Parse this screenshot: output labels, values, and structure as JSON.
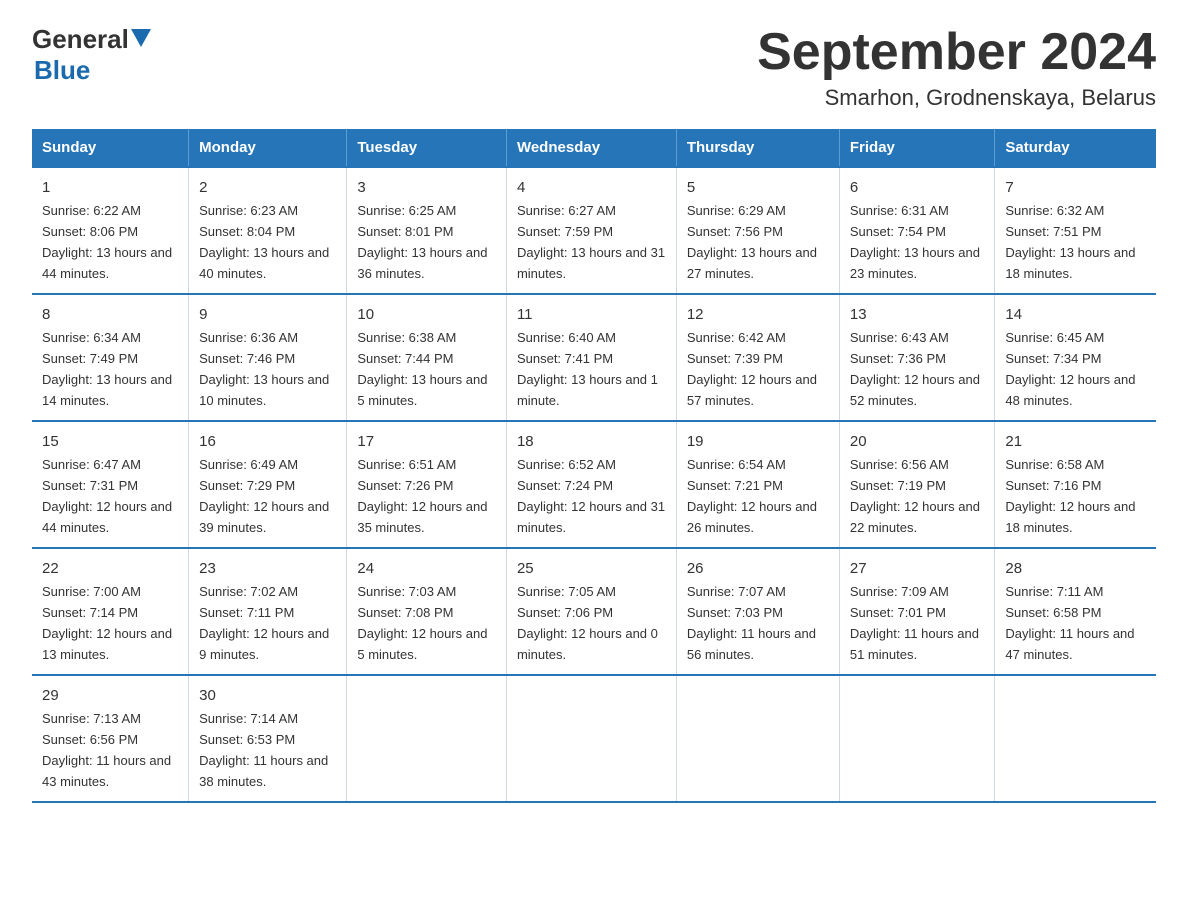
{
  "header": {
    "logo_general": "General",
    "logo_blue": "Blue",
    "main_title": "September 2024",
    "subtitle": "Smarhon, Grodnenskaya, Belarus"
  },
  "columns": [
    "Sunday",
    "Monday",
    "Tuesday",
    "Wednesday",
    "Thursday",
    "Friday",
    "Saturday"
  ],
  "weeks": [
    [
      {
        "day": "1",
        "sunrise": "Sunrise: 6:22 AM",
        "sunset": "Sunset: 8:06 PM",
        "daylight": "Daylight: 13 hours and 44 minutes."
      },
      {
        "day": "2",
        "sunrise": "Sunrise: 6:23 AM",
        "sunset": "Sunset: 8:04 PM",
        "daylight": "Daylight: 13 hours and 40 minutes."
      },
      {
        "day": "3",
        "sunrise": "Sunrise: 6:25 AM",
        "sunset": "Sunset: 8:01 PM",
        "daylight": "Daylight: 13 hours and 36 minutes."
      },
      {
        "day": "4",
        "sunrise": "Sunrise: 6:27 AM",
        "sunset": "Sunset: 7:59 PM",
        "daylight": "Daylight: 13 hours and 31 minutes."
      },
      {
        "day": "5",
        "sunrise": "Sunrise: 6:29 AM",
        "sunset": "Sunset: 7:56 PM",
        "daylight": "Daylight: 13 hours and 27 minutes."
      },
      {
        "day": "6",
        "sunrise": "Sunrise: 6:31 AM",
        "sunset": "Sunset: 7:54 PM",
        "daylight": "Daylight: 13 hours and 23 minutes."
      },
      {
        "day": "7",
        "sunrise": "Sunrise: 6:32 AM",
        "sunset": "Sunset: 7:51 PM",
        "daylight": "Daylight: 13 hours and 18 minutes."
      }
    ],
    [
      {
        "day": "8",
        "sunrise": "Sunrise: 6:34 AM",
        "sunset": "Sunset: 7:49 PM",
        "daylight": "Daylight: 13 hours and 14 minutes."
      },
      {
        "day": "9",
        "sunrise": "Sunrise: 6:36 AM",
        "sunset": "Sunset: 7:46 PM",
        "daylight": "Daylight: 13 hours and 10 minutes."
      },
      {
        "day": "10",
        "sunrise": "Sunrise: 6:38 AM",
        "sunset": "Sunset: 7:44 PM",
        "daylight": "Daylight: 13 hours and 5 minutes."
      },
      {
        "day": "11",
        "sunrise": "Sunrise: 6:40 AM",
        "sunset": "Sunset: 7:41 PM",
        "daylight": "Daylight: 13 hours and 1 minute."
      },
      {
        "day": "12",
        "sunrise": "Sunrise: 6:42 AM",
        "sunset": "Sunset: 7:39 PM",
        "daylight": "Daylight: 12 hours and 57 minutes."
      },
      {
        "day": "13",
        "sunrise": "Sunrise: 6:43 AM",
        "sunset": "Sunset: 7:36 PM",
        "daylight": "Daylight: 12 hours and 52 minutes."
      },
      {
        "day": "14",
        "sunrise": "Sunrise: 6:45 AM",
        "sunset": "Sunset: 7:34 PM",
        "daylight": "Daylight: 12 hours and 48 minutes."
      }
    ],
    [
      {
        "day": "15",
        "sunrise": "Sunrise: 6:47 AM",
        "sunset": "Sunset: 7:31 PM",
        "daylight": "Daylight: 12 hours and 44 minutes."
      },
      {
        "day": "16",
        "sunrise": "Sunrise: 6:49 AM",
        "sunset": "Sunset: 7:29 PM",
        "daylight": "Daylight: 12 hours and 39 minutes."
      },
      {
        "day": "17",
        "sunrise": "Sunrise: 6:51 AM",
        "sunset": "Sunset: 7:26 PM",
        "daylight": "Daylight: 12 hours and 35 minutes."
      },
      {
        "day": "18",
        "sunrise": "Sunrise: 6:52 AM",
        "sunset": "Sunset: 7:24 PM",
        "daylight": "Daylight: 12 hours and 31 minutes."
      },
      {
        "day": "19",
        "sunrise": "Sunrise: 6:54 AM",
        "sunset": "Sunset: 7:21 PM",
        "daylight": "Daylight: 12 hours and 26 minutes."
      },
      {
        "day": "20",
        "sunrise": "Sunrise: 6:56 AM",
        "sunset": "Sunset: 7:19 PM",
        "daylight": "Daylight: 12 hours and 22 minutes."
      },
      {
        "day": "21",
        "sunrise": "Sunrise: 6:58 AM",
        "sunset": "Sunset: 7:16 PM",
        "daylight": "Daylight: 12 hours and 18 minutes."
      }
    ],
    [
      {
        "day": "22",
        "sunrise": "Sunrise: 7:00 AM",
        "sunset": "Sunset: 7:14 PM",
        "daylight": "Daylight: 12 hours and 13 minutes."
      },
      {
        "day": "23",
        "sunrise": "Sunrise: 7:02 AM",
        "sunset": "Sunset: 7:11 PM",
        "daylight": "Daylight: 12 hours and 9 minutes."
      },
      {
        "day": "24",
        "sunrise": "Sunrise: 7:03 AM",
        "sunset": "Sunset: 7:08 PM",
        "daylight": "Daylight: 12 hours and 5 minutes."
      },
      {
        "day": "25",
        "sunrise": "Sunrise: 7:05 AM",
        "sunset": "Sunset: 7:06 PM",
        "daylight": "Daylight: 12 hours and 0 minutes."
      },
      {
        "day": "26",
        "sunrise": "Sunrise: 7:07 AM",
        "sunset": "Sunset: 7:03 PM",
        "daylight": "Daylight: 11 hours and 56 minutes."
      },
      {
        "day": "27",
        "sunrise": "Sunrise: 7:09 AM",
        "sunset": "Sunset: 7:01 PM",
        "daylight": "Daylight: 11 hours and 51 minutes."
      },
      {
        "day": "28",
        "sunrise": "Sunrise: 7:11 AM",
        "sunset": "Sunset: 6:58 PM",
        "daylight": "Daylight: 11 hours and 47 minutes."
      }
    ],
    [
      {
        "day": "29",
        "sunrise": "Sunrise: 7:13 AM",
        "sunset": "Sunset: 6:56 PM",
        "daylight": "Daylight: 11 hours and 43 minutes."
      },
      {
        "day": "30",
        "sunrise": "Sunrise: 7:14 AM",
        "sunset": "Sunset: 6:53 PM",
        "daylight": "Daylight: 11 hours and 38 minutes."
      },
      null,
      null,
      null,
      null,
      null
    ]
  ]
}
